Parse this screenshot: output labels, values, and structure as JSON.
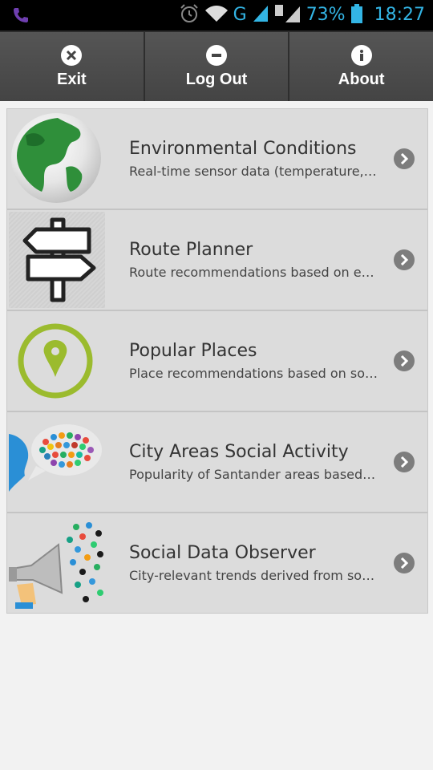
{
  "status_bar": {
    "network": "G",
    "battery": "73%",
    "time": "18:27"
  },
  "toolbar": {
    "buttons": [
      {
        "label": "Exit",
        "icon": "close-icon"
      },
      {
        "label": "Log Out",
        "icon": "minus-icon"
      },
      {
        "label": "About",
        "icon": "info-icon"
      }
    ]
  },
  "menu": {
    "items": [
      {
        "title": "Environmental Conditions",
        "subtitle": "Real-time sensor data (temperature, noise, CO)",
        "icon": "globe-icon"
      },
      {
        "title": "Route Planner",
        "subtitle": "Route recommendations based on environmental data",
        "icon": "signpost-icon"
      },
      {
        "title": "Popular Places",
        "subtitle": "Place recommendations based on social data",
        "icon": "map-pin-icon"
      },
      {
        "title": "City Areas Social Activity",
        "subtitle": "Popularity of Santander areas based on social data",
        "icon": "speech-bubble-icon"
      },
      {
        "title": "Social Data Observer",
        "subtitle": "City-relevant trends derived from social data",
        "icon": "megaphone-icon"
      }
    ]
  },
  "colors": {
    "accent": "#33b5e5",
    "toolbar_bg": "#4a4a4a",
    "list_bg": "#dcdcdc",
    "pin_green": "#9bbb2e"
  }
}
